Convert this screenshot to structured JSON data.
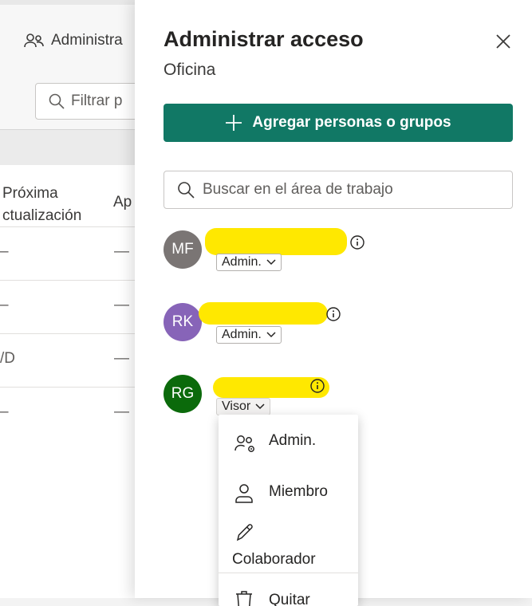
{
  "background": {
    "manage_label": "Administra",
    "filter_placeholder": "Filtrar p",
    "col_next_update": "Próxima\nctualización",
    "col_app": "Ap",
    "rows": [
      {
        "c1": "–",
        "c2": "—"
      },
      {
        "c1": "–",
        "c2": "—"
      },
      {
        "c1": "/D",
        "c2": "—"
      },
      {
        "c1": "–",
        "c2": "—"
      }
    ]
  },
  "panel": {
    "title": "Administrar acceso",
    "subtitle": "Oficina",
    "add_button_label": "Agregar personas o grupos",
    "search_placeholder": "Buscar en el área de trabajo",
    "users": [
      {
        "initials": "MF",
        "color": "#7a7574",
        "role": "Admin."
      },
      {
        "initials": "RK",
        "color": "#8764b8",
        "role": "Admin."
      },
      {
        "initials": "RG",
        "color": "#0b6a0b",
        "role": "Visor"
      }
    ]
  },
  "role_menu": {
    "items": [
      {
        "label": "Admin.",
        "icon": "people-settings-icon"
      },
      {
        "label": "Miembro",
        "icon": "person-icon"
      },
      {
        "label": "Colaborador",
        "icon": "pencil-icon"
      },
      {
        "label": "Quitar",
        "icon": "trash-icon"
      }
    ]
  },
  "colors": {
    "accent": "#117865",
    "redaction": "#ffe800"
  }
}
